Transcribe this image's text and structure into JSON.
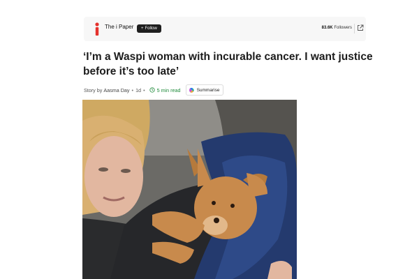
{
  "publisher": {
    "name": "The i Paper",
    "follow_label": "Follow",
    "follow_plus": "+",
    "followers_count": "83.6K",
    "followers_label": "Followers",
    "logo_color": "#e5322d"
  },
  "article": {
    "headline": "‘I’m a Waspi woman with incurable cancer. I want justice before it’s too late’",
    "byline_prefix": "Story by",
    "author": "Aasma Day",
    "age": "1d",
    "read_time": "5 min read",
    "summarise_label": "Summarise"
  },
  "photo": {
    "icon": "photo-woman-with-dog"
  },
  "colors": {
    "read_time": "#1e8a3a",
    "follow_bg": "#1f1f1f"
  }
}
